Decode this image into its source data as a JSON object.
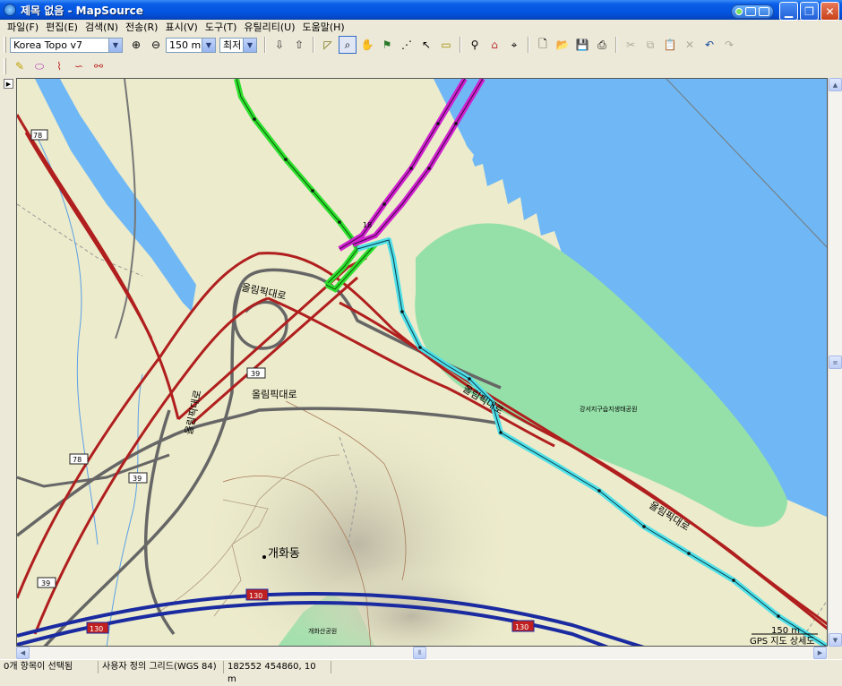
{
  "window": {
    "title": "제목 없음 - MapSource"
  },
  "menu": [
    "파일(F)",
    "편집(E)",
    "검색(N)",
    "전송(R)",
    "표시(V)",
    "도구(T)",
    "유틸리티(U)",
    "도움말(H)"
  ],
  "toolbar": {
    "map_product": "Korea Topo v7",
    "zoom_scale": "150 m",
    "detail_level": "최저"
  },
  "map": {
    "labels": {
      "olympic_road_1": "올림픽대로",
      "olympic_road_2": "올림픽대로",
      "olympic_road_3": "올림픽대로",
      "olympic_road_4": "올림픽대로",
      "olympic_road_5": "올림픽대로",
      "district": "개화동",
      "park_east": "강서지구습지생태공원",
      "park_south": "개화산공원",
      "waypoint": "18"
    },
    "shields": {
      "r78a": "78",
      "r78b": "78",
      "r39a": "39",
      "r39b": "39",
      "r39c": "39",
      "r130a": "130",
      "r130b": "130",
      "r130c": "130"
    },
    "scale_text": "150 m",
    "source_text": "GPS 지도 상세도"
  },
  "status": {
    "selection": "0개 항목이 선택됨",
    "grid": "사용자 정의 그리드(WGS 84)",
    "position": "182552 454860, 10 m"
  }
}
